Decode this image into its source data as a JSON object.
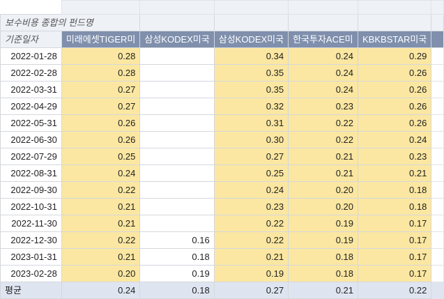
{
  "sheet": {
    "title_label": "보수비용 종합의 펀드명",
    "row_label": "기준일자",
    "columns": [
      "미래에셋TIGER미",
      "삼성KODEX미국",
      "삼성KODEX미국",
      "한국투자ACE미",
      "KBKBSTAR미국"
    ],
    "rows": [
      {
        "date": "2022-01-28",
        "v": [
          "0.28",
          "",
          "0.34",
          "0.24",
          "0.29"
        ]
      },
      {
        "date": "2022-02-28",
        "v": [
          "0.28",
          "",
          "0.35",
          "0.24",
          "0.26"
        ]
      },
      {
        "date": "2022-03-31",
        "v": [
          "0.27",
          "",
          "0.35",
          "0.24",
          "0.26"
        ]
      },
      {
        "date": "2022-04-29",
        "v": [
          "0.27",
          "",
          "0.32",
          "0.23",
          "0.26"
        ]
      },
      {
        "date": "2022-05-31",
        "v": [
          "0.26",
          "",
          "0.31",
          "0.22",
          "0.26"
        ]
      },
      {
        "date": "2022-06-30",
        "v": [
          "0.26",
          "",
          "0.30",
          "0.22",
          "0.24"
        ]
      },
      {
        "date": "2022-07-29",
        "v": [
          "0.25",
          "",
          "0.27",
          "0.21",
          "0.23"
        ]
      },
      {
        "date": "2022-08-31",
        "v": [
          "0.24",
          "",
          "0.25",
          "0.21",
          "0.21"
        ]
      },
      {
        "date": "2022-09-30",
        "v": [
          "0.22",
          "",
          "0.24",
          "0.20",
          "0.18"
        ]
      },
      {
        "date": "2022-10-31",
        "v": [
          "0.21",
          "",
          "0.23",
          "0.20",
          "0.18"
        ]
      },
      {
        "date": "2022-11-30",
        "v": [
          "0.21",
          "",
          "0.22",
          "0.19",
          "0.17"
        ]
      },
      {
        "date": "2022-12-30",
        "v": [
          "0.22",
          "0.16",
          "0.22",
          "0.19",
          "0.17"
        ]
      },
      {
        "date": "2023-01-31",
        "v": [
          "0.21",
          "0.18",
          "0.21",
          "0.18",
          "0.17"
        ]
      },
      {
        "date": "2023-02-28",
        "v": [
          "0.20",
          "0.19",
          "0.19",
          "0.18",
          "0.17"
        ]
      }
    ],
    "average": {
      "label": "평균",
      "v": [
        "0.24",
        "0.18",
        "0.27",
        "0.21",
        "0.22"
      ]
    },
    "colors": {
      "header": "#7f8fac",
      "highlight": "#fbe7a1",
      "average": "#dfe5f0",
      "grid": "#d4d7dc"
    }
  }
}
